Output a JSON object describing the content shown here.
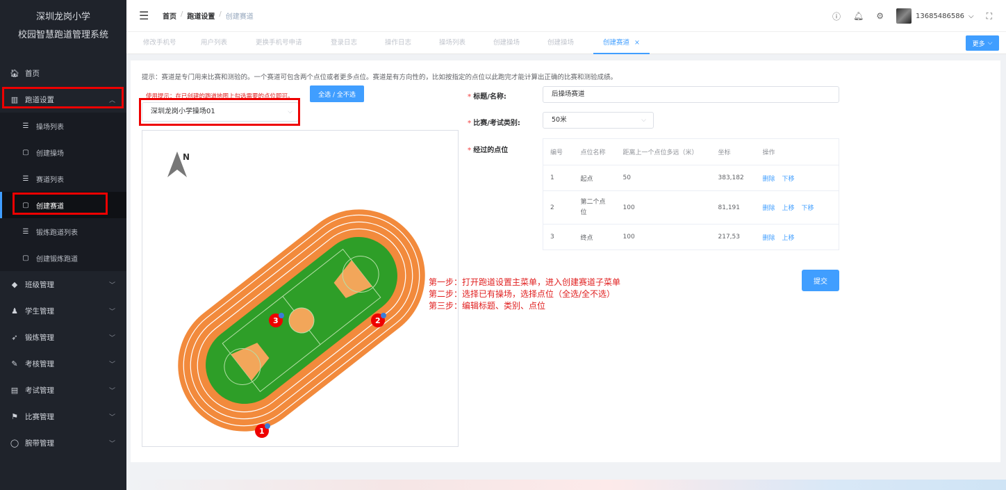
{
  "sidebar": {
    "school": "深圳龙岗小学",
    "system": "校园智慧跑道管理系统",
    "items": [
      {
        "icon": "home-icon",
        "glyph": "🏠︎",
        "label": "首页"
      },
      {
        "icon": "track-icon",
        "glyph": "▥",
        "label": "跑道设置"
      },
      {
        "icon": "list-icon",
        "glyph": "☰",
        "label": "操场列表"
      },
      {
        "icon": "create-icon",
        "glyph": "▢",
        "label": "创建操场"
      },
      {
        "icon": "list-icon",
        "glyph": "☰",
        "label": "赛道列表"
      },
      {
        "icon": "create-icon",
        "glyph": "▢",
        "label": "创建赛道"
      },
      {
        "icon": "list-icon",
        "glyph": "☰",
        "label": "锻炼跑道列表"
      },
      {
        "icon": "create-icon",
        "glyph": "▢",
        "label": "创建锻炼跑道"
      },
      {
        "icon": "class-icon",
        "glyph": "◆",
        "label": "班级管理"
      },
      {
        "icon": "student-icon",
        "glyph": "♟",
        "label": "学生管理"
      },
      {
        "icon": "run-icon",
        "glyph": "➶",
        "label": "锻炼管理"
      },
      {
        "icon": "exam-icon",
        "glyph": "✎",
        "label": "考核管理"
      },
      {
        "icon": "test-icon",
        "glyph": "▤",
        "label": "考试管理"
      },
      {
        "icon": "flag-icon",
        "glyph": "⚑",
        "label": "比赛管理"
      },
      {
        "icon": "band-icon",
        "glyph": "◯",
        "label": "腕带管理"
      }
    ]
  },
  "header": {
    "breadcrumb": [
      "首页",
      "跑道设置",
      "创建赛道"
    ],
    "user": "13685486586"
  },
  "tabs": [
    "修改手机号",
    "用户列表",
    "更换手机号申请",
    "登录日志",
    "操作日志",
    "操场列表",
    "创建操场",
    "创建操场",
    "创建赛道"
  ],
  "tab_close": "×",
  "more": "更多",
  "hint": "提示：赛道是专门用来比赛和测验的。一个赛道可包含两个点位或者更多点位。赛道是有方向性的，比如按指定的点位以此跑完才能计算出正确的比赛和测验成绩。",
  "tip": "使用提示：在已创建的跑道地图上勾选需要的点位即可。",
  "select_all": "全选 / 全不选",
  "field": "深圳龙岗小学操场01",
  "form": {
    "title_label": "标题/名称:",
    "title_value": "后操场赛道",
    "type_label": "比赛/考试类别:",
    "type_value": "50米",
    "points_label": "经过的点位"
  },
  "table": {
    "headers": [
      "编号",
      "点位名称",
      "距离上一个点位多远（米）",
      "坐标",
      "操作"
    ],
    "rows": [
      {
        "no": "1",
        "name": "起点",
        "dist": "50",
        "coord": "383,182",
        "ops": [
          "删除",
          "下移"
        ]
      },
      {
        "no": "2",
        "name": "第二个点位",
        "dist": "100",
        "coord": "81,191",
        "ops": [
          "删除",
          "上移",
          "下移"
        ]
      },
      {
        "no": "3",
        "name": "终点",
        "dist": "100",
        "coord": "217,53",
        "ops": [
          "删除",
          "上移"
        ]
      }
    ]
  },
  "submit": "提交",
  "steps": [
    "第一步：打开跑道设置主菜单，进入创建赛道子菜单",
    "第二步：选择已有操场，选择点位（全选/全不选）",
    "第三步：编辑标题、类别、点位"
  ],
  "map": {
    "north": "N",
    "markers": [
      "1",
      "2",
      "3"
    ]
  },
  "colors": {
    "accent": "#409eff",
    "highlight": "#e00000",
    "track": "#f28a3c",
    "field": "#2e9e28"
  }
}
